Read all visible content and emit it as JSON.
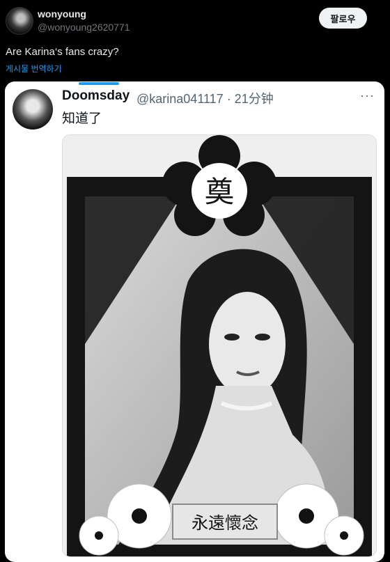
{
  "post": {
    "author_name": "wonyoung",
    "author_handle": "@wonyoung2620771",
    "follow_label": "팔로우",
    "text": "Are Karina‘s fans crazy?",
    "translate_label": "게시물 번역하기"
  },
  "quoted": {
    "author_name": "Doomsday",
    "meta": "@karina041117 · 21分钟",
    "text": "知道了",
    "more_label": "···",
    "image": {
      "top_char": "奠",
      "banner_text": "永遠懷念"
    }
  },
  "colors": {
    "background": "#000000",
    "link": "#1d9bf0",
    "card": "#ffffff"
  }
}
